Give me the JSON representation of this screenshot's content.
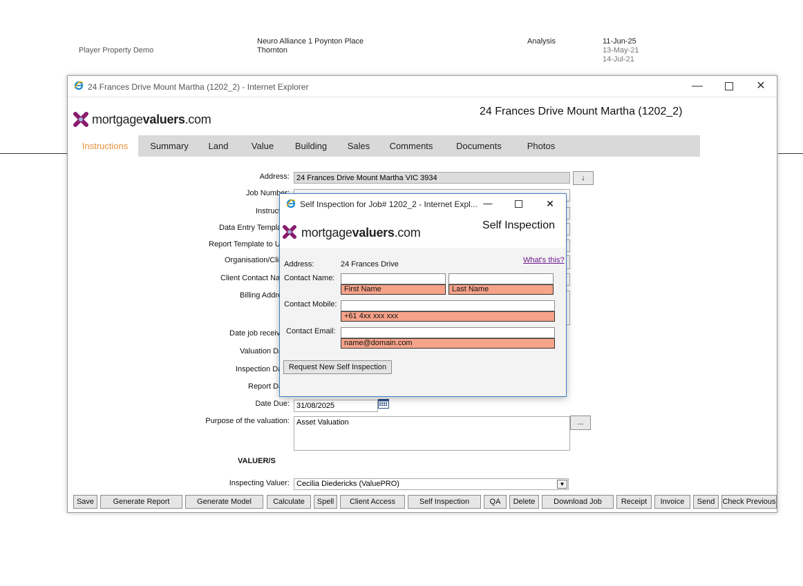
{
  "background_row": {
    "name": "Player Property Demo",
    "address_line1": "Neuro Alliance 1 Poynton Place",
    "address_line2": "Thornton",
    "type": "Analysis",
    "date1": "11-Jun-25",
    "date2": "13-May-21",
    "date3": "14-Jul-21"
  },
  "main_window": {
    "title": "24 Frances Drive  Mount Martha  (1202_2) - Internet Explorer",
    "header_title": "24 Frances Drive  Mount Martha  (1202_2)",
    "logo": {
      "prefix": "mortgage",
      "bold": "valuers",
      "suffix": ".com"
    },
    "tabs": [
      {
        "label": "Instructions",
        "active": true
      },
      {
        "label": "Summary"
      },
      {
        "label": "Land"
      },
      {
        "label": "Value"
      },
      {
        "label": "Building"
      },
      {
        "label": "Sales"
      },
      {
        "label": "Comments"
      },
      {
        "label": "Documents"
      },
      {
        "label": "Photos"
      }
    ],
    "form": {
      "address_label": "Address:",
      "address_value": "24 Frances Drive Mount Martha VIC 3934",
      "address_btn": "↓",
      "job_number_label": "Job Number:",
      "instruction_label": "Instruction",
      "data_entry_label": "Data Entry Template",
      "report_template_label": "Report Template to U",
      "organisation_label": "Organisation/Clie",
      "client_contact_label": "Client Contact Nar",
      "billing_label": "Billing Addre",
      "date_job_label": "Date job receiv",
      "valuation_date_label": "Valuation Da",
      "inspection_date_label": "Inspection Da",
      "report_date_label": "Report Da",
      "date_due_label": "Date Due:",
      "date_due_value": "31/08/2025",
      "purpose_label": "Purpose of the valuation:",
      "purpose_value": "Asset Valuation",
      "purpose_btn": "...",
      "valuers_heading": "VALUER/S",
      "inspecting_label": "Inspecting Valuer:",
      "inspecting_value": "Cecilia Diedericks (ValuePRO)"
    },
    "buttons": [
      "Save",
      "Generate Report",
      "Generate Model",
      "Calculate",
      "Spell",
      "Client Access",
      "Self Inspection",
      "QA",
      "Delete",
      "Download Job",
      "Receipt",
      "Invoice",
      "Send",
      "Check Previous"
    ]
  },
  "popup": {
    "title": "Self Inspection for Job# 1202_2 - Internet Expl...",
    "header_title": "Self Inspection",
    "whats_this": "What's this?",
    "address_label": "Address:",
    "address_value": "24 Frances Drive",
    "contact_name_label": "Contact Name:",
    "first_name_hint": "First Name",
    "last_name_hint": "Last Name",
    "contact_mobile_label": "Contact Mobile:",
    "mobile_hint": "+61 4xx xxx xxx",
    "contact_email_label": "Contact Email:",
    "email_hint": "name@domain.com",
    "request_btn": "Request New Self Inspection"
  },
  "colors": {
    "accent_tab": "#e8923a",
    "hint_fill": "#f6a38a",
    "popup_border": "#3d7fc4",
    "logo_magenta": "#8a1c6e"
  }
}
